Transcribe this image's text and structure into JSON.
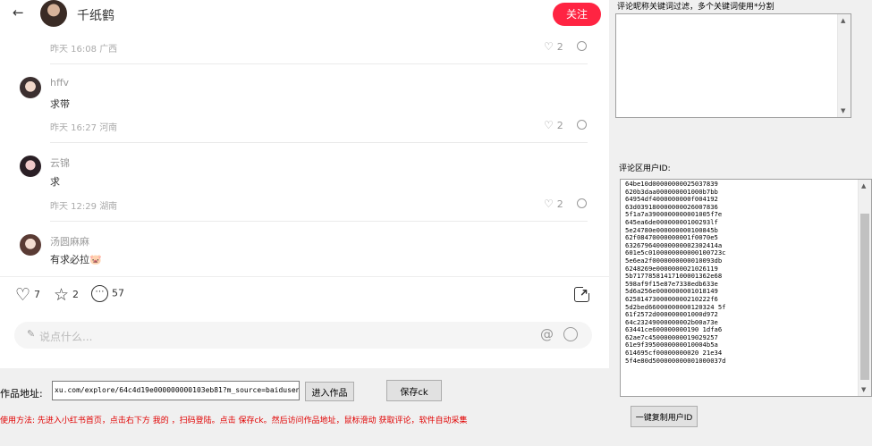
{
  "browser": {
    "back_icon": "←",
    "author": {
      "name": "千纸鹤"
    },
    "follow_label": "关注",
    "comments": [
      {
        "name": "",
        "text": "",
        "time": "昨天 16:08",
        "location": "广西",
        "likes": "2"
      },
      {
        "name": "hffv",
        "text": "求带",
        "time": "昨天 16:27",
        "location": "河南",
        "likes": "2"
      },
      {
        "name": "云锦",
        "text": "求",
        "time": "昨天 12:29",
        "location": "湖南",
        "likes": "2"
      },
      {
        "name": "汤圆麻麻",
        "text": "有求必拉🐷",
        "time": "",
        "location": "",
        "likes": ""
      }
    ],
    "actions": {
      "likes": "7",
      "collects": "2",
      "comments": "57"
    },
    "comment_placeholder": "说点什么...",
    "icons": {
      "heart": "♡",
      "star": "☆",
      "chat": "⋯",
      "pen": "✎",
      "at": "@"
    }
  },
  "controls": {
    "url_label": "作品地址:",
    "url_value": "xu.com/explore/64c4d19e000000000103eb81?m_source=baidusen",
    "enter_button": "进入作品",
    "save_ck_button": "保存ck",
    "usage_text": "使用方法: 先进入小红书首页，点击右下方 我的 ，扫码登陆。点击 保存ck。然后访问作品地址，鼠标滑动 获取评论，软件自动采集"
  },
  "panel": {
    "keyword_label": "评论昵称关键词过滤，多个关键词使用*分割",
    "keyword_value": "",
    "userid_label": "评论区用户ID:",
    "user_ids": [
      "64be10d00000000025037839",
      "620b3daa000000001000b7bb",
      "64954df4000000000f004192",
      "63d039180000000026007836",
      "5f1a7a3900000000001005f7e",
      "645ea6de00000000100293lf",
      "5e24780e000000000100845b",
      "62f08470000000001f0070e5",
      "632679640000000002302414a",
      "601e5c0100000000000100723c",
      "5e6ea2f0000000000010093db",
      "6248269e0000000021026119",
      "5b71778581417100001362e68",
      "598af9f15e87e7338edb633e",
      "5d6a256e0000000001018149",
      "6258147300000000210222f6",
      "5d2bed66000000000120324 5f",
      "61f2572d000000001000d972",
      "64c23249000000002b00a73e",
      "63441ce600000000190 1dfa6",
      "62ae7c450000000019029257",
      "61e9f3950000000010004b5a",
      "614695cf00000000020 21e34",
      "5f4e80d500000000001000037d"
    ],
    "copy_button": "一键复制用户ID"
  }
}
